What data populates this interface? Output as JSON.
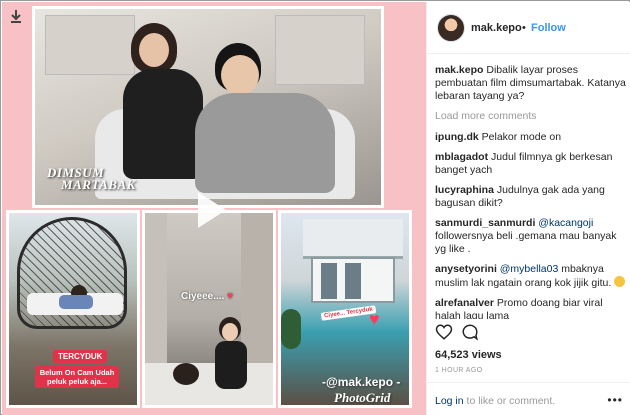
{
  "post": {
    "username": "mak.kepo",
    "follow_label": "Follow",
    "separator": "•",
    "caption_user": "mak.kepo",
    "caption_text": " Dibalik layar proses pembuatan film dimsumartabak. Katanya lebaran tayang ya?",
    "load_more": "Load more comments",
    "views": "64,523 views",
    "time_ago": "1 HOUR AGO",
    "login_link": "Log in",
    "login_rest": " to like or comment.",
    "more_dots": "•••"
  },
  "comments": [
    {
      "user": "ipung.dk",
      "text": " Pelakor mode on"
    },
    {
      "user": "mblagadot",
      "text": " Judul filmnya gk berkesan banget yach"
    },
    {
      "user": "lucyraphina",
      "text": " Judulnya gak ada yang bagusan dikit?"
    },
    {
      "user": "sanmurdi_sanmurdi",
      "mention": " @kacangoji",
      "text": " followersnya beli .gemana mau banyak yg like ."
    },
    {
      "user": "anysetyorini",
      "mention": " @mybella03",
      "text": " mbaknya muslim lak ngatain orang kok jijik gitu. "
    },
    {
      "user": "alrefanalver",
      "text": " Promo doang biar viral halah lagu lama"
    }
  ],
  "media": {
    "movie_logo_line1": "DIMSUM",
    "movie_logo_line2": "MARTABAK",
    "tag_tercyduk": "TERCYDUK",
    "tag_sub": "Belum On Cam Udah peluk peluk aja...",
    "ciyee": "Ciyeee....",
    "ciyee_small": "Ciyee... Tercyduk",
    "watermark_handle": "-@mak.kepo -",
    "watermark_brand": "PhotoGrid"
  },
  "colors": {
    "pink_bg": "#f7c1c6",
    "follow_blue": "#3897f0",
    "link_dark": "#003569",
    "tag_red": "#e0334a"
  },
  "icons": [
    "download-icon",
    "play-icon",
    "heart-icon",
    "comment-icon"
  ]
}
